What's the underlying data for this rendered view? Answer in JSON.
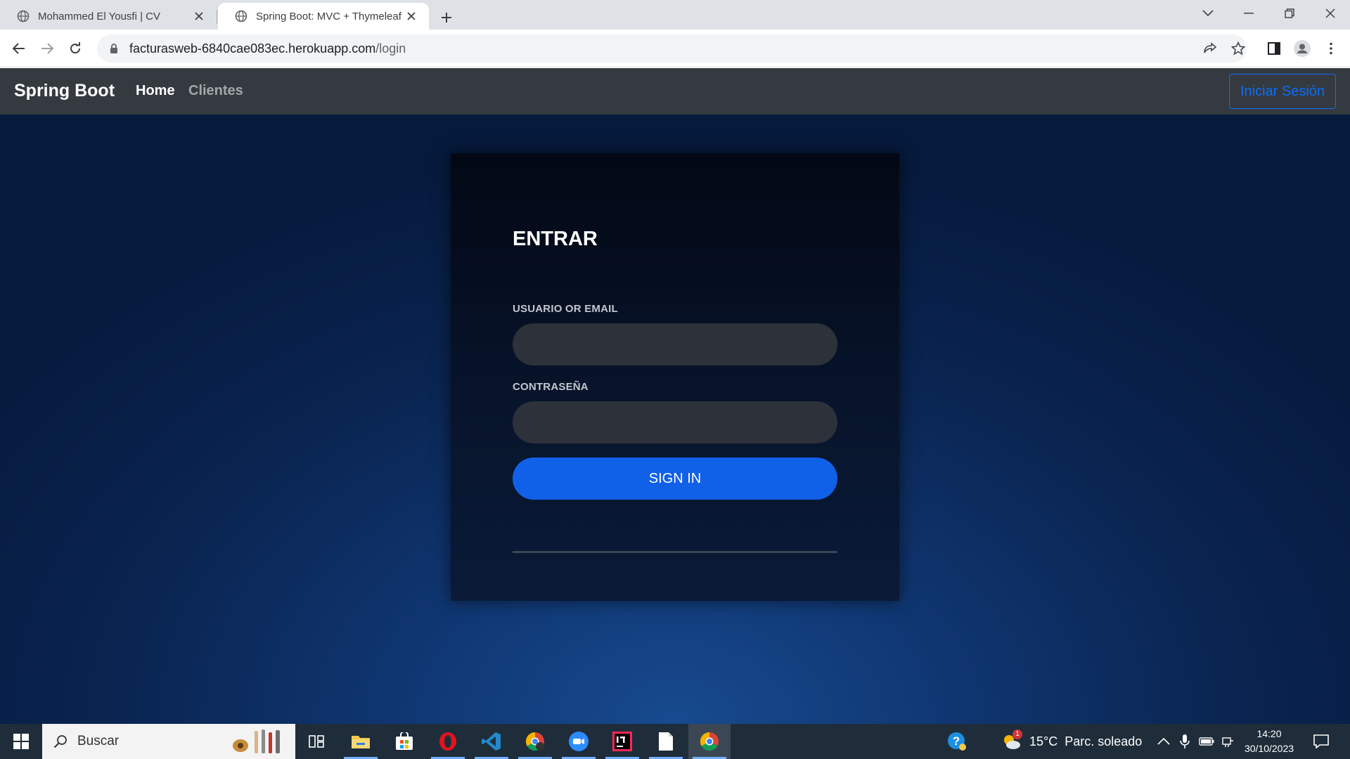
{
  "browser": {
    "tabs": [
      {
        "title": "Mohammed El Yousfi | CV",
        "active": false
      },
      {
        "title": "Spring Boot: MVC + Thymeleaf",
        "active": true
      }
    ],
    "url_host": "facturasweb-6840cae083ec.herokuapp.com",
    "url_path": "/login"
  },
  "navbar": {
    "brand": "Spring Boot",
    "links": [
      "Home",
      "Clientes"
    ],
    "login_button": "Iniciar Sesión",
    "accent_color": "#0d6efd"
  },
  "login": {
    "title": "ENTRAR",
    "username_label": "USUARIO OR EMAIL",
    "username_value": "",
    "password_label": "CONTRASEÑA",
    "password_value": "",
    "submit_label": "SIGN IN",
    "button_color": "#1160e8"
  },
  "taskbar": {
    "search_placeholder": "Buscar",
    "apps": [
      "file-explorer-icon",
      "microsoft-store-icon",
      "opera-icon",
      "vscode-icon",
      "chrome-profile-icon",
      "zoom-icon",
      "intellij-icon",
      "notepad-icon",
      "chrome-icon"
    ],
    "weather_badge": "1",
    "weather": "15°C  Parc. soleado",
    "time": "14:20",
    "date": "30/10/2023"
  }
}
